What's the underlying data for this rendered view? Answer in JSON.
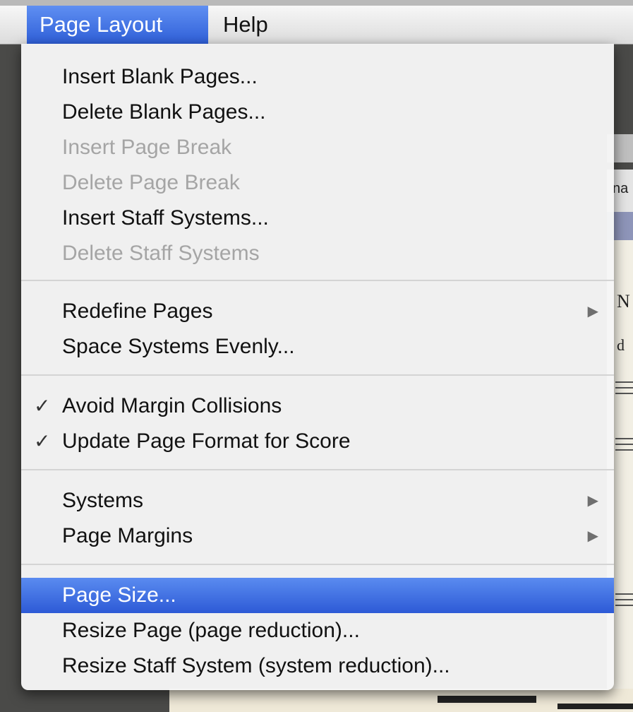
{
  "menubar": {
    "page_layout": "Page Layout",
    "help": "Help"
  },
  "menu": {
    "items": [
      {
        "label": "Insert Blank Pages...",
        "enabled": true
      },
      {
        "label": "Delete Blank Pages...",
        "enabled": true
      },
      {
        "label": "Insert Page Break",
        "enabled": false
      },
      {
        "label": "Delete Page Break",
        "enabled": false
      },
      {
        "label": "Insert Staff Systems...",
        "enabled": true
      },
      {
        "label": "Delete Staff Systems",
        "enabled": false
      },
      {
        "label": "Redefine Pages",
        "enabled": true,
        "submenu": true
      },
      {
        "label": "Space Systems Evenly...",
        "enabled": true
      },
      {
        "label": "Avoid Margin Collisions",
        "enabled": true,
        "checked": true
      },
      {
        "label": "Update Page Format for Score",
        "enabled": true,
        "checked": true
      },
      {
        "label": "Systems",
        "enabled": true,
        "submenu": true
      },
      {
        "label": "Page Margins",
        "enabled": true,
        "submenu": true
      },
      {
        "label": "Page Size...",
        "enabled": true,
        "highlighted": true
      },
      {
        "label": "Resize Page (page reduction)...",
        "enabled": true
      },
      {
        "label": "Resize Staff System (system reduction)...",
        "enabled": true
      }
    ],
    "check_mark": "✓",
    "submenu_arrow": "▶"
  },
  "background": {
    "score_fragments": [
      "na",
      "N",
      "d"
    ]
  },
  "colors": {
    "highlight": "#2d5ad6",
    "disabled_text": "#a5a5a5"
  }
}
